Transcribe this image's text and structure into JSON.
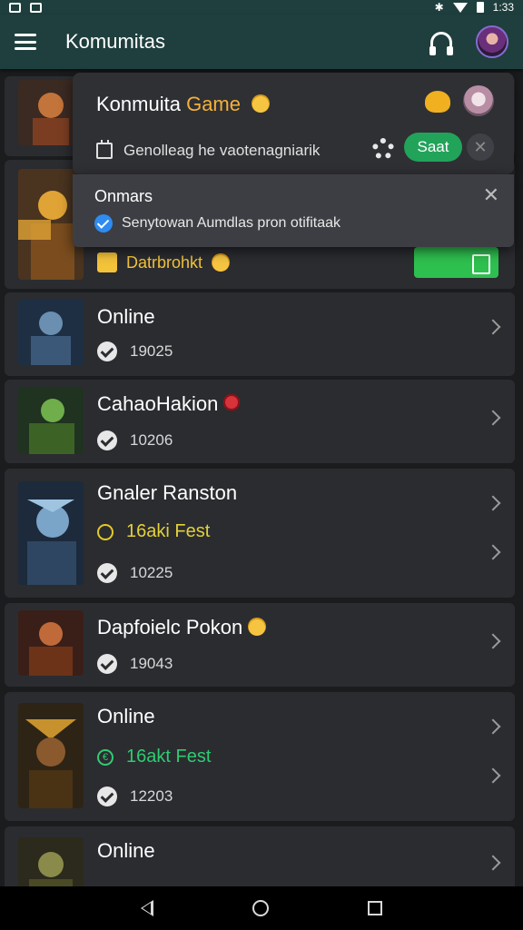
{
  "status_bar": {
    "time": "1:33"
  },
  "app_bar": {
    "title": "Komumitas"
  },
  "popup_game": {
    "title_main": "Konmuita",
    "title_accent": "Game",
    "subtitle": "Genolleag he vaotenagniarik",
    "save_label": "Saat"
  },
  "popup_notice": {
    "title": "Onmars",
    "message": "Senytowan Aumdlas pron otifitaak"
  },
  "cards": [
    {
      "title": "",
      "thumb_colors": [
        "#3b2a22",
        "#c2743a"
      ]
    },
    {
      "label": "Datrbrohkt",
      "thumb_colors": [
        "#4a3420",
        "#e0a335"
      ]
    },
    {
      "title": "Online",
      "count": "19025",
      "thumb_colors": [
        "#1e2f44",
        "#6a8fb0"
      ]
    },
    {
      "title": "CahaoHakion",
      "count": "10206",
      "thumb_colors": [
        "#1f3320",
        "#6fae4a"
      ]
    },
    {
      "title": "Gnaler Ranston",
      "fest": "16aki Fest",
      "count": "10225",
      "thumb_colors": [
        "#1c2a3c",
        "#7aa4c8"
      ]
    },
    {
      "title": "Dapfoielc Pokon",
      "count": "19043",
      "thumb_colors": [
        "#3a1f18",
        "#c06a3a"
      ]
    },
    {
      "title": "Online",
      "fest": "16akt Fest",
      "count": "12203",
      "thumb_colors": [
        "#2e2416",
        "#c7922e"
      ]
    },
    {
      "title": "Online",
      "thumb_colors": [
        "#2c2a1c",
        "#8a8a4a"
      ]
    }
  ]
}
